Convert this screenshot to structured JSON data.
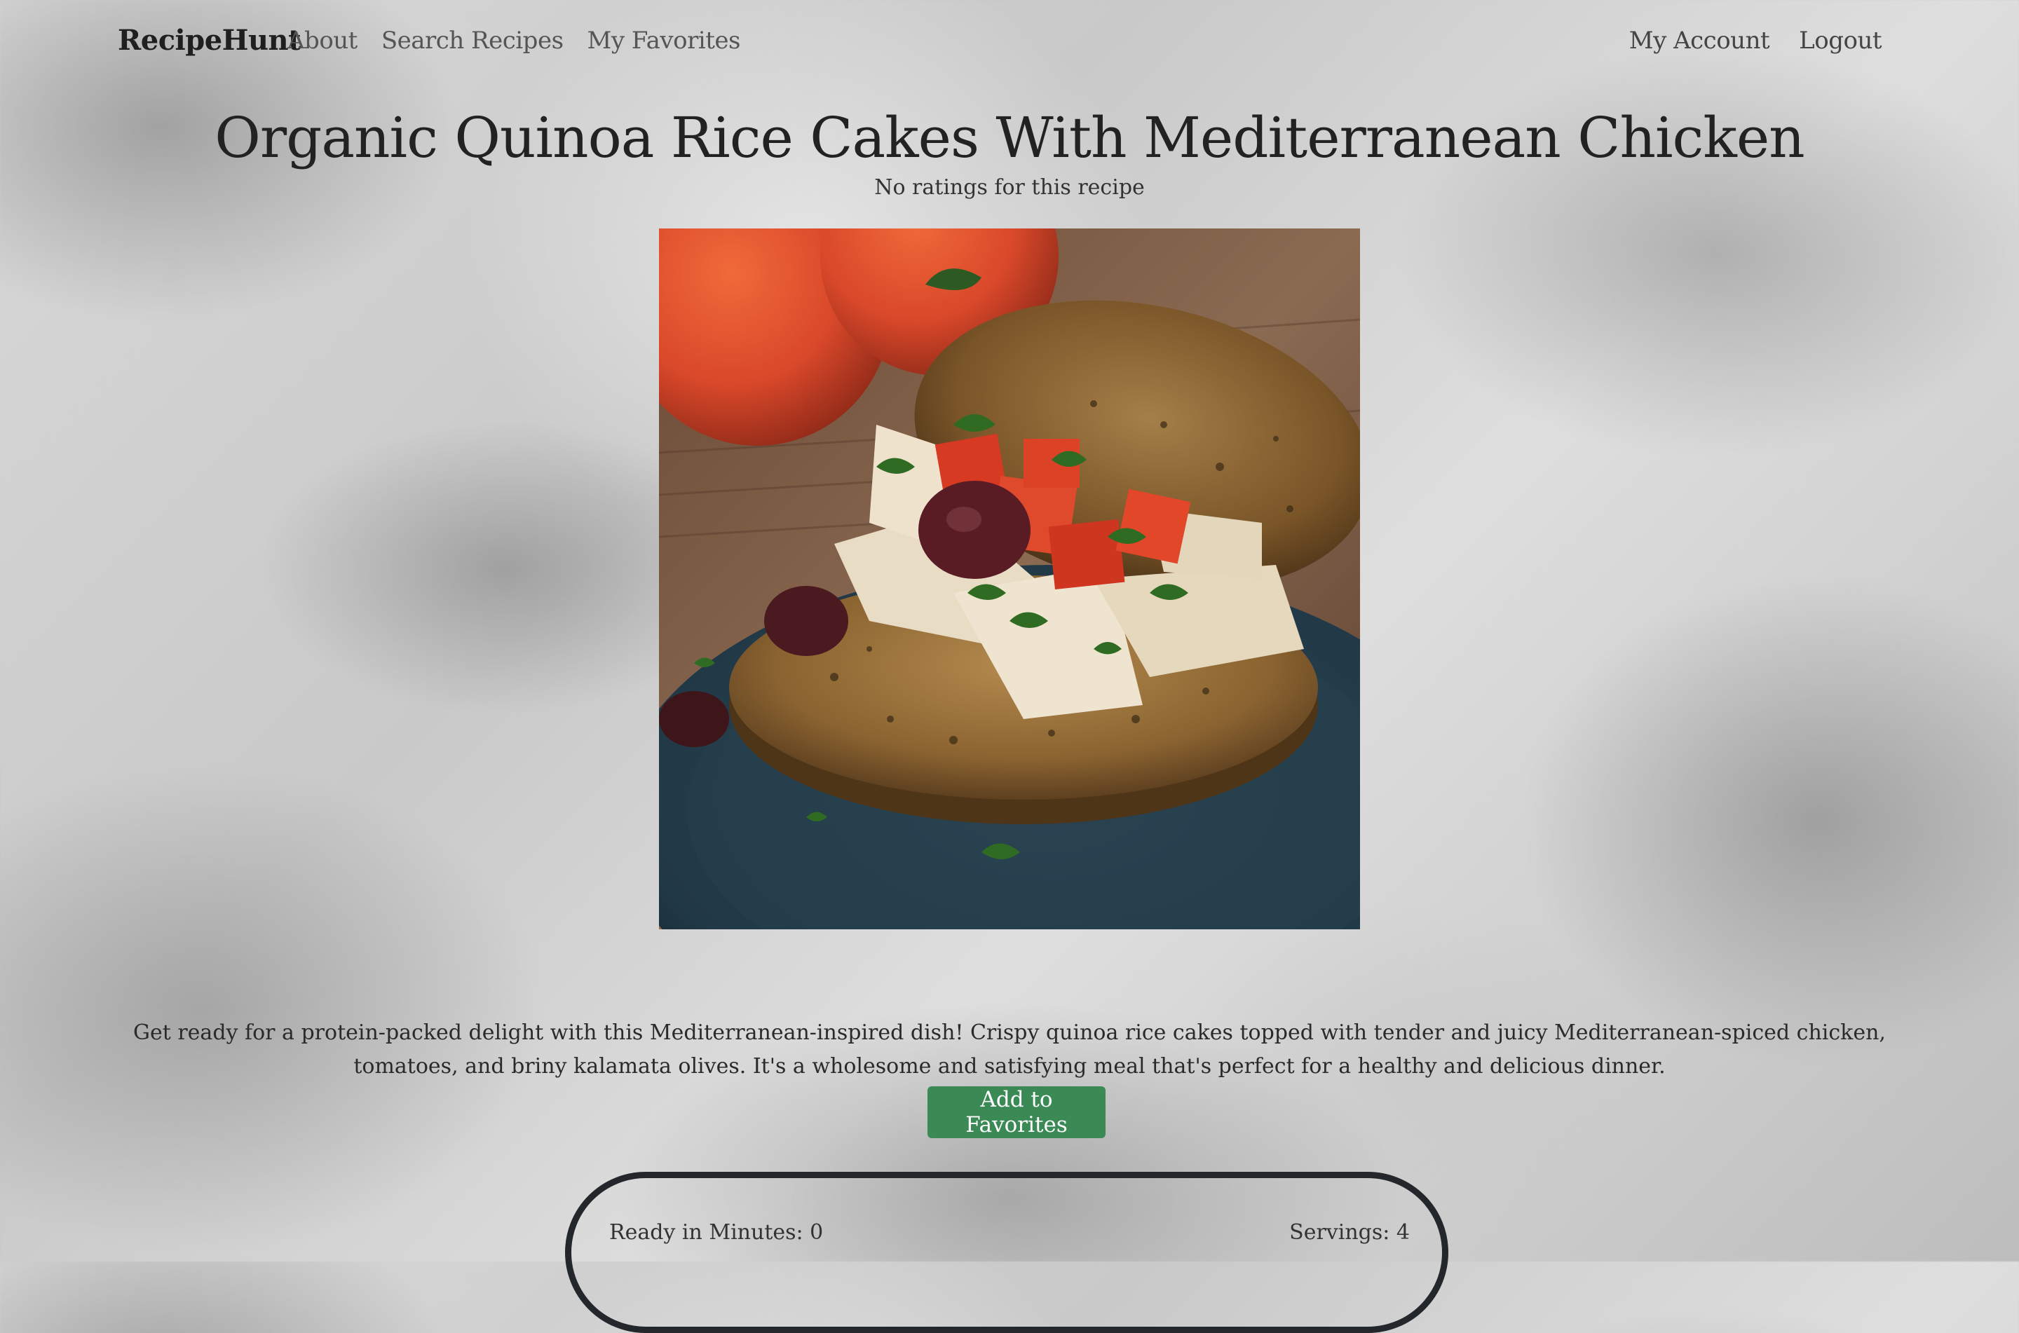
{
  "navbar": {
    "brand": "RecipeHunt",
    "left_links": [
      "About",
      "Search Recipes",
      "My Favorites"
    ],
    "right_links": [
      "My Account",
      "Logout"
    ]
  },
  "recipe": {
    "title": "Organic Quinoa Rice Cakes With Mediterranean Chicken",
    "rating_text": "No ratings for this recipe",
    "image_alt": "quinoa-rice-cake-with-chicken-tomato-olive-photo",
    "description": "Get ready for a protein-packed delight with this Mediterranean-inspired dish! Crispy quinoa rice cakes topped with tender and juicy Mediterranean-spiced chicken, tomatoes, and briny kalamata olives. It's a wholesome and satisfying meal that's perfect for a healthy and delicious dinner.",
    "favorite_button": "Add to Favorites",
    "ready_in": "Ready in Minutes: 0",
    "servings": "Servings: 4"
  },
  "colors": {
    "button_bg": "#3b8a56",
    "pill_border": "#23272b"
  }
}
